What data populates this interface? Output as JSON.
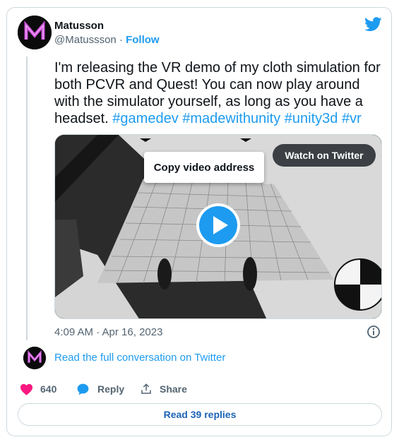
{
  "author": {
    "name": "Matusson",
    "handle": "@Matussson",
    "separator": "·",
    "follow_label": "Follow"
  },
  "tweet": {
    "text": "I'm releasing the VR demo of my cloth simulation for both PCVR and Quest! You can now play around with the simulator yourself, as long as you have a headset.",
    "hashtags": [
      "#gamedev",
      "#madewithunity",
      "#unity3d",
      "#vr"
    ]
  },
  "media": {
    "copy_video_label": "Copy video address",
    "watch_label": "Watch on Twitter"
  },
  "timestamp": "4:09 AM · Apr 16, 2023",
  "read_full_label": "Read the full conversation on Twitter",
  "actions": {
    "like_count": "640",
    "reply_label": "Reply",
    "share_label": "Share"
  },
  "read_replies_label": "Read 39 replies",
  "icons": {
    "brand": "twitter-bird-icon",
    "info": "info-icon",
    "like": "heart-icon",
    "reply": "reply-bubble-icon",
    "share": "share-icon",
    "play": "play-icon"
  },
  "colors": {
    "accent": "#1d9bf0",
    "like": "#f91880",
    "text": "#0f1419",
    "muted": "#536471",
    "border": "#cfd9de"
  }
}
